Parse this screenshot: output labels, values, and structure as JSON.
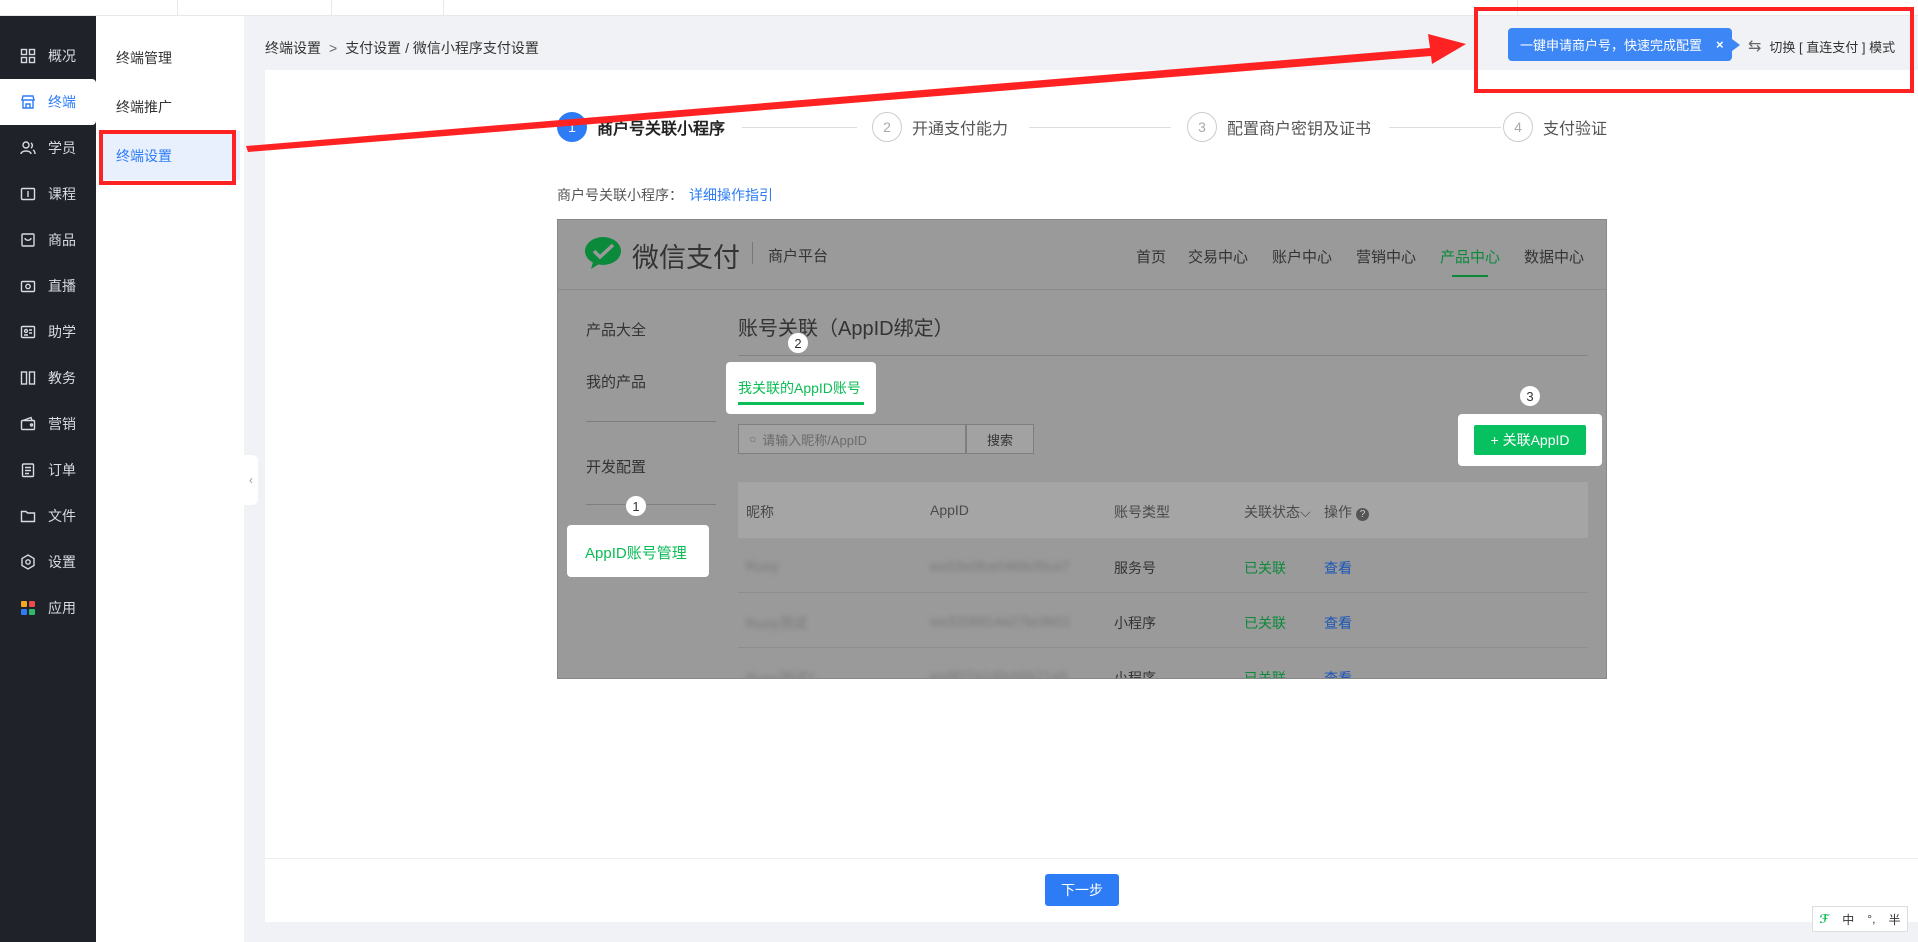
{
  "sidebar": {
    "items": [
      {
        "label": "概况",
        "icon": "grid-icon"
      },
      {
        "label": "终端",
        "icon": "store-icon",
        "active": true
      },
      {
        "label": "学员",
        "icon": "users-icon"
      },
      {
        "label": "课程",
        "icon": "course-icon"
      },
      {
        "label": "商品",
        "icon": "bag-icon"
      },
      {
        "label": "直播",
        "icon": "live-icon"
      },
      {
        "label": "助学",
        "icon": "assist-icon"
      },
      {
        "label": "教务",
        "icon": "book-icon"
      },
      {
        "label": "营销",
        "icon": "wallet-icon"
      },
      {
        "label": "订单",
        "icon": "order-icon"
      },
      {
        "label": "文件",
        "icon": "folder-icon"
      },
      {
        "label": "设置",
        "icon": "gear-icon"
      },
      {
        "label": "应用",
        "icon": "apps-icon"
      }
    ]
  },
  "submenu": {
    "items": [
      {
        "label": "终端管理"
      },
      {
        "label": "终端推广"
      },
      {
        "label": "终端设置",
        "active": true
      }
    ]
  },
  "breadcrumb": {
    "first": "终端设置",
    "separator": ">",
    "second": "支付设置 / 微信小程序支付设置"
  },
  "topright": {
    "tip": "一键申请商户号，快速完成配置",
    "close": "×",
    "switch_label": "切换 [ 直连支付 ] 模式"
  },
  "steps": [
    {
      "num": "1",
      "label": "商户号关联小程序",
      "active": true
    },
    {
      "num": "2",
      "label": "开通支付能力"
    },
    {
      "num": "3",
      "label": "配置商户密钥及证书"
    },
    {
      "num": "4",
      "label": "支付验证"
    }
  ],
  "guide": {
    "label": "商户号关联小程序：",
    "link": "详细操作指引"
  },
  "wechat": {
    "brand": "微信支付",
    "platform": "商户平台",
    "nav": [
      "首页",
      "交易中心",
      "账户中心",
      "营销中心",
      "产品中心",
      "数据中心"
    ],
    "nav_active": "产品中心",
    "left_menu": [
      "产品大全",
      "我的产品",
      "开发配置"
    ],
    "section_title": "账号关联（AppID绑定）",
    "tab": "我关联的AppID账号",
    "search_placeholder": "请输入昵称/AppID",
    "search_button": "搜索",
    "add_button": "+ 关联AppID",
    "mgmt_label": "AppID账号管理",
    "badges": [
      "1",
      "2",
      "3"
    ],
    "table": {
      "headers": [
        "昵称",
        "AppID",
        "账号类型",
        "关联状态",
        "操作"
      ],
      "rows": [
        {
          "name": "Ruoy",
          "appid": "wx03e0fce0468cf5ce7",
          "type": "服务号",
          "status": "已关联",
          "action": "查看"
        },
        {
          "name": "Ruoy测试",
          "appid": "wx3206814a27bc9b01",
          "type": "小程序",
          "status": "已关联",
          "action": "查看"
        },
        {
          "name": "Ruoy测试2",
          "appid": "wx9f27a1d0cb5b71a9",
          "type": "小程序",
          "status": "已关联",
          "action": "查看"
        }
      ]
    }
  },
  "footer": {
    "next": "下一步"
  },
  "ime": [
    "中",
    "°,",
    "半"
  ],
  "colors": {
    "primary": "#2d7cf6",
    "sidebar_bg": "#1f2229",
    "wechat_green": "#07c160",
    "annotation_red": "#ff2222"
  }
}
